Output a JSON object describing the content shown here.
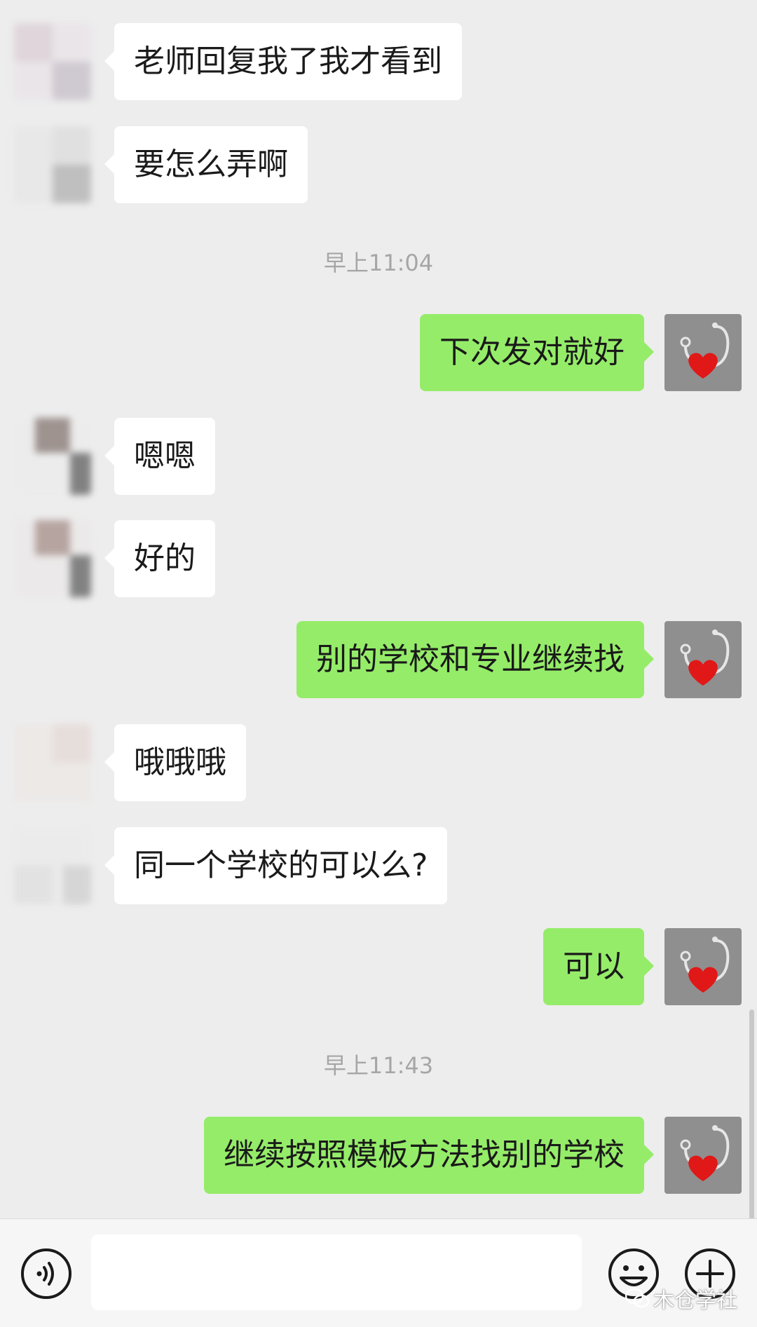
{
  "messages": [
    {
      "side": "in",
      "text": "老师回复我了我才看到"
    },
    {
      "side": "in",
      "text": "要怎么弄啊"
    },
    {
      "side": "time",
      "text": "早上11:04"
    },
    {
      "side": "out",
      "text": "下次发对就好"
    },
    {
      "side": "in",
      "text": "嗯嗯"
    },
    {
      "side": "in",
      "text": "好的"
    },
    {
      "side": "out",
      "text": "别的学校和专业继续找"
    },
    {
      "side": "in",
      "text": "哦哦哦"
    },
    {
      "side": "in",
      "text": "同一个学校的可以么?"
    },
    {
      "side": "out",
      "text": "可以"
    },
    {
      "side": "time",
      "text": "早上11:43"
    },
    {
      "side": "out",
      "text": "继续按照模板方法找别的学校"
    }
  ],
  "icons": {
    "voice": "voice-icon",
    "emoji": "emoji-icon",
    "plus": "plus-icon",
    "own_avatar": "heart-stethoscope-icon"
  },
  "colors": {
    "outgoing_bubble": "#95ec69",
    "incoming_bubble": "#ffffff",
    "background": "#ededed"
  },
  "watermark": {
    "text": "木仓学社"
  }
}
